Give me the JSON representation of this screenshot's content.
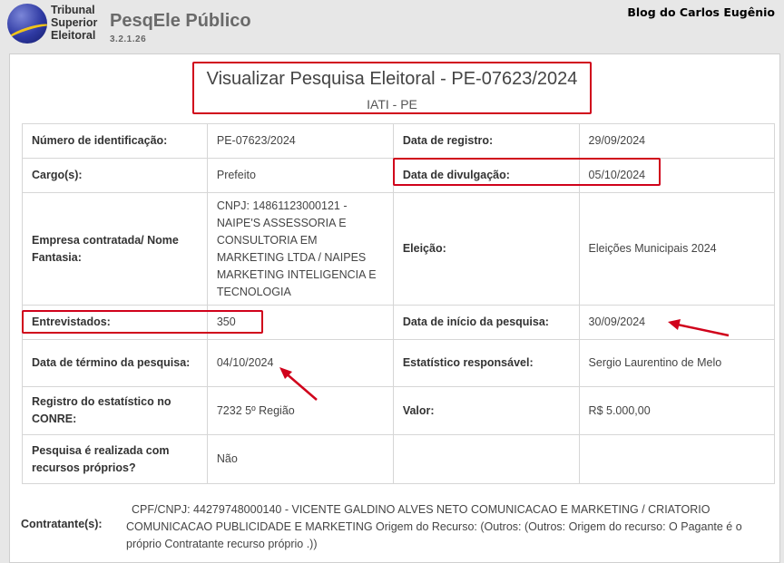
{
  "header": {
    "logo_lines": [
      "Tribunal",
      "Superior",
      "Eleitoral"
    ],
    "app_title": "PesqEle Público",
    "app_version": "3.2.1.26",
    "blog_name": "Blog do Carlos Eugênio"
  },
  "page": {
    "title": "Visualizar Pesquisa Eleitoral - PE-07623/2024",
    "subtitle": "IATI - PE"
  },
  "fields": {
    "numero_label": "Número de identificação:",
    "numero_value": "PE-07623/2024",
    "data_registro_label": "Data de registro:",
    "data_registro_value": "29/09/2024",
    "cargo_label": "Cargo(s):",
    "cargo_value": "Prefeito",
    "data_divulgacao_label": "Data de divulgação:",
    "data_divulgacao_value": "05/10/2024",
    "empresa_label": "Empresa contratada/ Nome Fantasia:",
    "empresa_value": "CNPJ: 14861123000121 - NAIPE'S ASSESSORIA E CONSULTORIA EM MARKETING LTDA / NAIPES MARKETING INTELIGENCIA E TECNOLOGIA",
    "eleicao_label": "Eleição:",
    "eleicao_value": "Eleições Municipais 2024",
    "entrevistados_label": "Entrevistados:",
    "entrevistados_value": "350",
    "data_inicio_label": "Data de início da pesquisa:",
    "data_inicio_value": "30/09/2024",
    "data_termino_label": "Data de término da pesquisa:",
    "data_termino_value": "04/10/2024",
    "estatistico_label": "Estatístico responsável:",
    "estatistico_value": "Sergio Laurentino de Melo",
    "registro_conre_label": "Registro do estatístico no CONRE:",
    "registro_conre_value": "7232 5º Região",
    "valor_label": "Valor:",
    "valor_value": "R$ 5.000,00",
    "recursos_proprios_label": "Pesquisa é realizada com recursos próprios?",
    "recursos_proprios_value": "Não",
    "contratante_label": "Contratante(s):",
    "contratante_value": "CPF/CNPJ: 44279748000140 - VICENTE GALDINO ALVES NETO COMUNICACAO E MARKETING / CRIATORIO COMUNICACAO PUBLICIDADE E MARKETING Origem do Recurso: (Outros: (Outros: Origem do recurso: O Pagante é o próprio Contratante recurso próprio .))"
  },
  "colors": {
    "highlight": "#d0021b",
    "brand_blue": "#2f3aa3",
    "brand_gold": "#f0c419"
  }
}
